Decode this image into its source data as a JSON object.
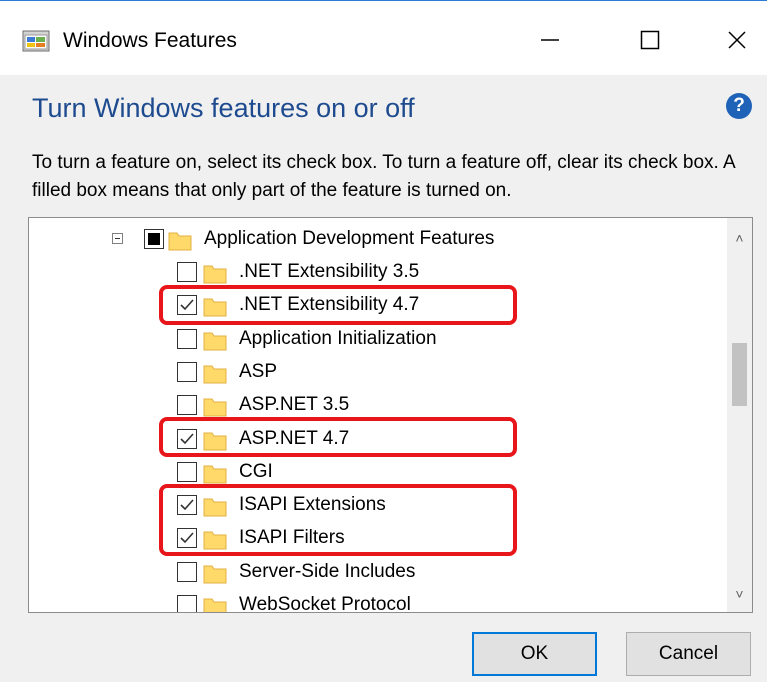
{
  "window": {
    "title": "Windows Features",
    "minimize_glyph": "—",
    "maximize_glyph": "☐",
    "close_glyph": "✕"
  },
  "header": {
    "heading": "Turn Windows features on or off",
    "help_glyph": "?",
    "description": "To turn a feature on, select its check box. To turn a feature off, clear its check box. A filled box means that only part of the feature is turned on."
  },
  "tree": {
    "parent": {
      "label": "Application Development Features",
      "state": "partial",
      "expanded": true
    },
    "items": [
      {
        "label": ".NET Extensibility 3.5",
        "checked": false,
        "highlighted": false
      },
      {
        "label": ".NET Extensibility 4.7",
        "checked": true,
        "highlighted": true
      },
      {
        "label": "Application Initialization",
        "checked": false,
        "highlighted": false
      },
      {
        "label": "ASP",
        "checked": false,
        "highlighted": false
      },
      {
        "label": "ASP.NET 3.5",
        "checked": false,
        "highlighted": false
      },
      {
        "label": "ASP.NET 4.7",
        "checked": true,
        "highlighted": true
      },
      {
        "label": "CGI",
        "checked": false,
        "highlighted": false
      },
      {
        "label": "ISAPI Extensions",
        "checked": true,
        "highlighted": true
      },
      {
        "label": "ISAPI Filters",
        "checked": true,
        "highlighted": true
      },
      {
        "label": "Server-Side Includes",
        "checked": false,
        "highlighted": false
      },
      {
        "label": "WebSocket Protocol",
        "checked": false,
        "highlighted": false
      }
    ],
    "scroll": {
      "up_glyph": "˄",
      "down_glyph": "˅",
      "thumb_fraction_start": 0.28,
      "thumb_fraction_size": 0.19
    }
  },
  "buttons": {
    "ok": "OK",
    "cancel": "Cancel"
  },
  "colors": {
    "accent": "#0078d7",
    "heading": "#1e4b8f",
    "highlight": "#e8161b",
    "folder": "#ffd96a"
  }
}
